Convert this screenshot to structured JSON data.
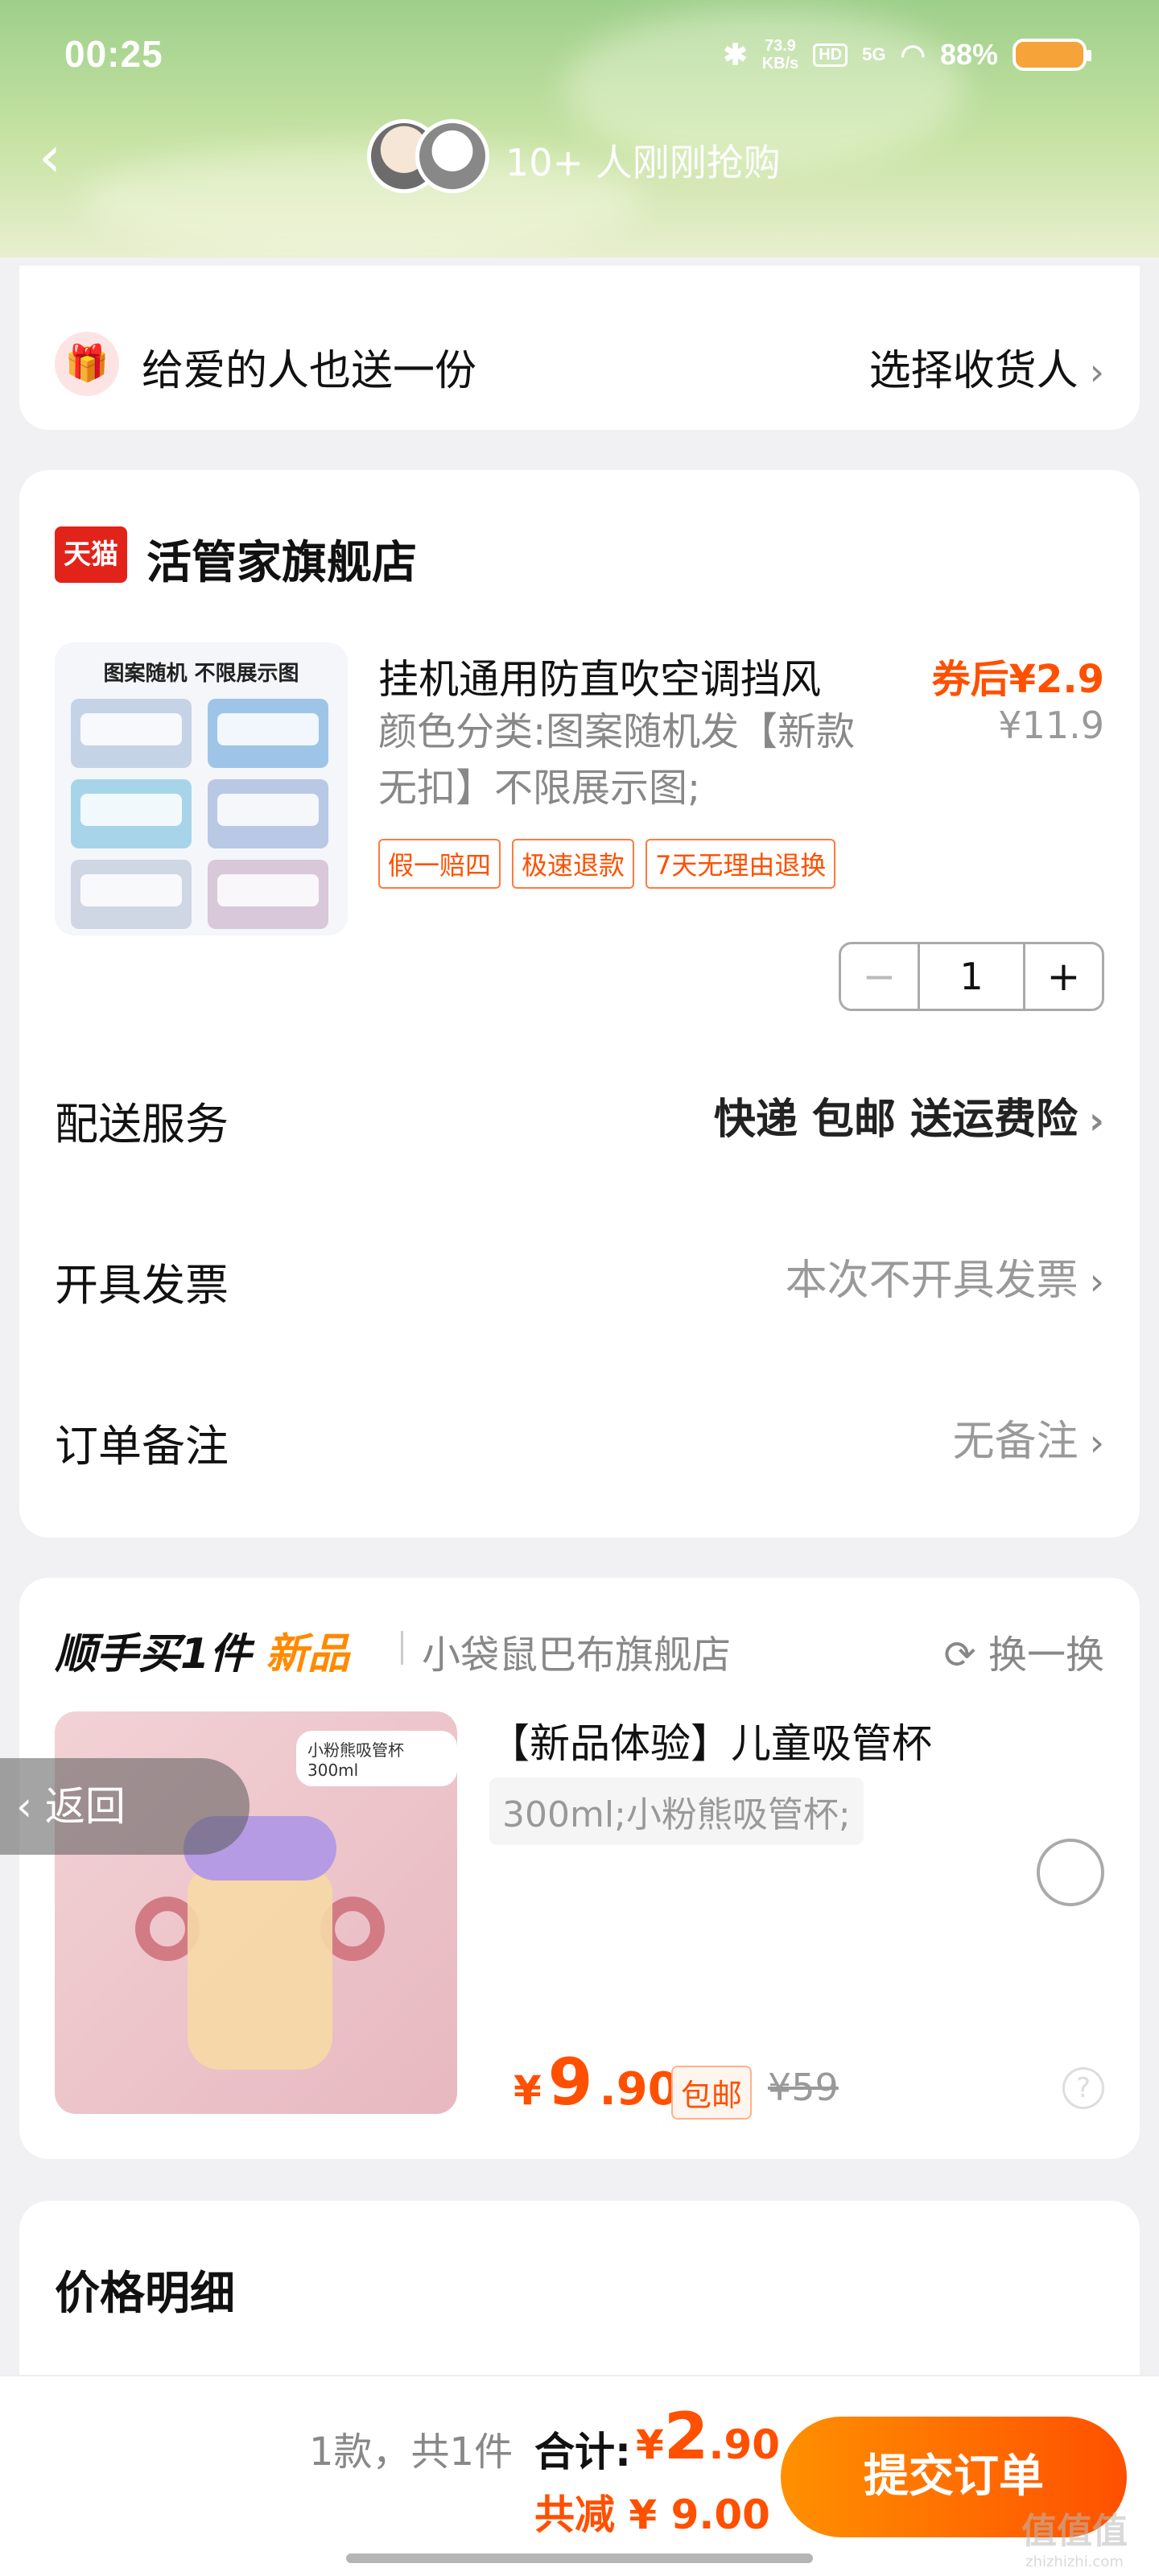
{
  "status": {
    "time": "00:25",
    "net_speed_top": "73.9",
    "net_speed_unit": "KB/s",
    "hd": "HD",
    "signal": "5G",
    "battery": "88%"
  },
  "nav": {
    "buyers_text": "10+ 人刚刚抢购"
  },
  "gift": {
    "label": "给爱的人也送一份",
    "action": "选择收货人"
  },
  "store": {
    "badge": "天猫",
    "name": "活管家旗舰店"
  },
  "product": {
    "image_caption": "图案随机 不限展示图",
    "title": "挂机通用防直吹空调挡风",
    "coupon_price": "券后¥2.9",
    "original_price": "¥11.9",
    "spec": "颜色分类:图案随机发【新款无扣】不限展示图;",
    "tags": [
      "假一赔四",
      "极速退款",
      "7天无理由退换"
    ],
    "quantity": "1"
  },
  "rows": {
    "delivery_label": "配送服务",
    "delivery_value": "快递 包邮 送运费险",
    "invoice_label": "开具发票",
    "invoice_value": "本次不开具发票",
    "note_label": "订单备注",
    "note_value": "无备注"
  },
  "upsell": {
    "title": "顺手买1件",
    "new_label": "新品",
    "store": "小袋鼠巴布旗舰店",
    "swap": "换一换",
    "image_label": "小粉熊吸管杯300ml",
    "item_title": "【新品体验】儿童吸管杯",
    "item_spec": "300ml;小粉熊吸管杯;",
    "price_symbol": "¥",
    "price_int": "9",
    "price_dec": ".90",
    "shipping_tag": "包邮",
    "orig_price": "¥59"
  },
  "float_back": "返回",
  "price_detail": {
    "title": "价格明细"
  },
  "checkout": {
    "count": "1款，共1件",
    "total_label": "合计:",
    "total_symbol": "¥",
    "total_int": "2",
    "total_dec": ".90",
    "saved": "共减 ¥ 9.00",
    "submit": "提交订单"
  },
  "watermark": {
    "logo": "值值值",
    "site": "zhizhizhi.com"
  },
  "colors": {
    "accent": "#ff5000",
    "tmall_red": "#e2231a",
    "header_green": "#9ecf8a"
  }
}
